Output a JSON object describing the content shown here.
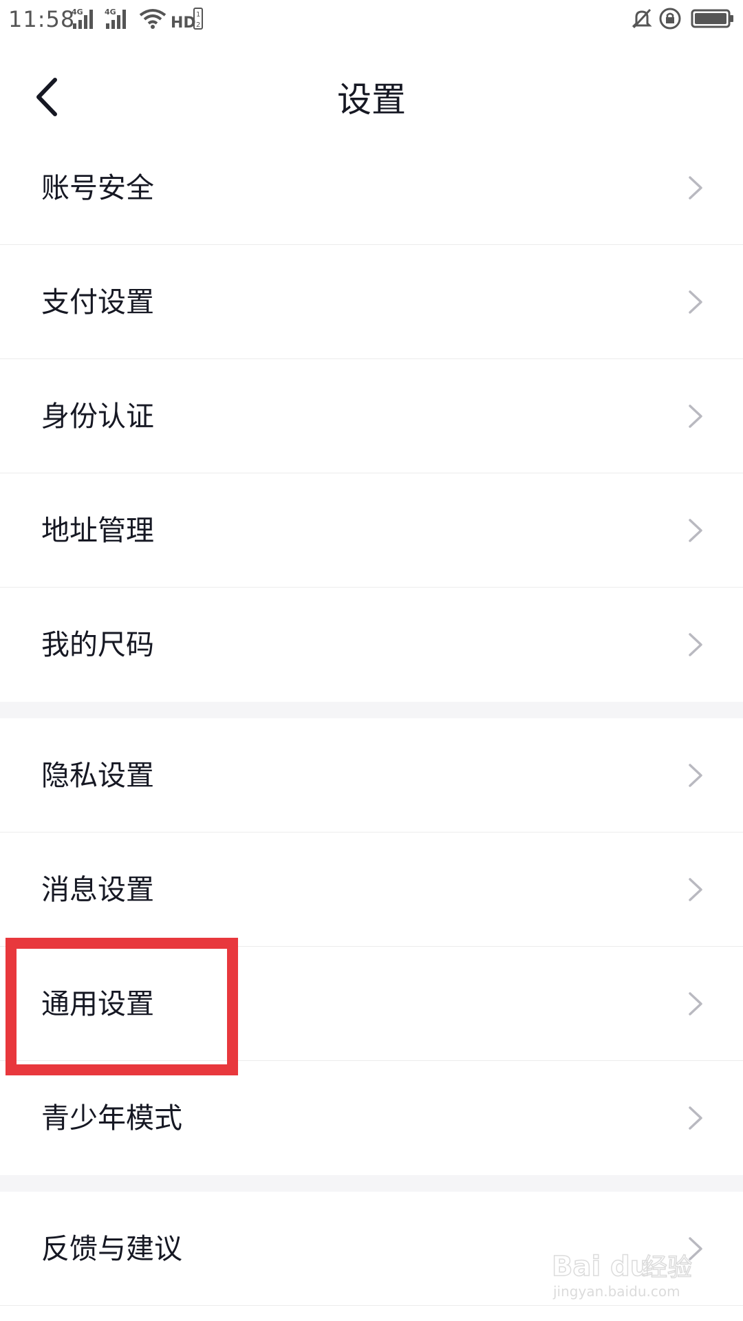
{
  "status_bar": {
    "time": "11:58",
    "network_1": "4G",
    "network_2": "4G",
    "hd_label": "HD",
    "icons": [
      "signal-icon",
      "signal-icon",
      "wifi-icon",
      "hd-icon",
      "mute-bell-icon",
      "rotation-lock-icon",
      "battery-icon"
    ]
  },
  "header": {
    "title": "设置",
    "back_icon": "back-arrow-icon"
  },
  "settings": {
    "groups": [
      {
        "items": [
          {
            "label": "账号安全"
          },
          {
            "label": "支付设置"
          },
          {
            "label": "身份认证"
          },
          {
            "label": "地址管理"
          },
          {
            "label": "我的尺码"
          }
        ]
      },
      {
        "items": [
          {
            "label": "隐私设置"
          },
          {
            "label": "消息设置"
          },
          {
            "label": "通用设置",
            "highlighted": true
          },
          {
            "label": "青少年模式"
          }
        ]
      },
      {
        "items": [
          {
            "label": "反馈与建议"
          }
        ]
      }
    ]
  },
  "colors": {
    "highlight": "#e8383d",
    "text": "#161823",
    "chevron": "#b9b9c0",
    "divider": "#ececec",
    "group_gap": "#f5f5f7"
  },
  "watermark": {
    "brand": "Bai du",
    "brand_cn": "经验",
    "site": "jingyan.baidu.com"
  }
}
